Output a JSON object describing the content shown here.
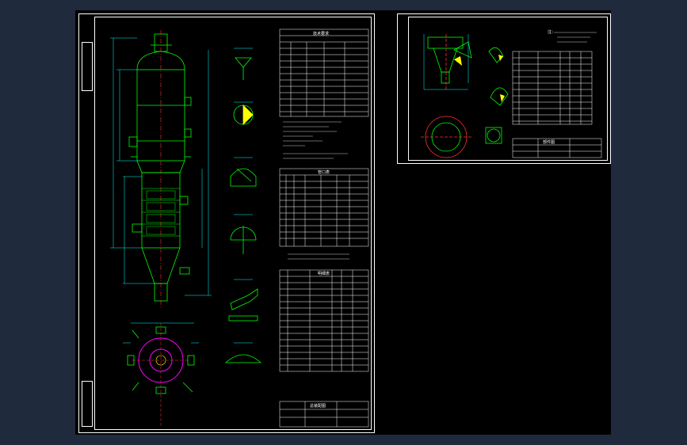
{
  "colors": {
    "background": "#1f2b3c",
    "model_space": "#000000",
    "border": "#ffffff",
    "geometry": "#00ff00",
    "centerline": "#ff3030",
    "dimension": "#00ffff",
    "highlight": "#ff00ff",
    "fill": "#ffff00"
  },
  "sheet_left": {
    "technical_requirements_title": "技术要求",
    "nozzle_table_title": "管口表",
    "parts_list_title": "明细表",
    "title_block": "总装配图"
  },
  "sheet_right": {
    "notes_title": "注：",
    "title_block": "部件图"
  }
}
